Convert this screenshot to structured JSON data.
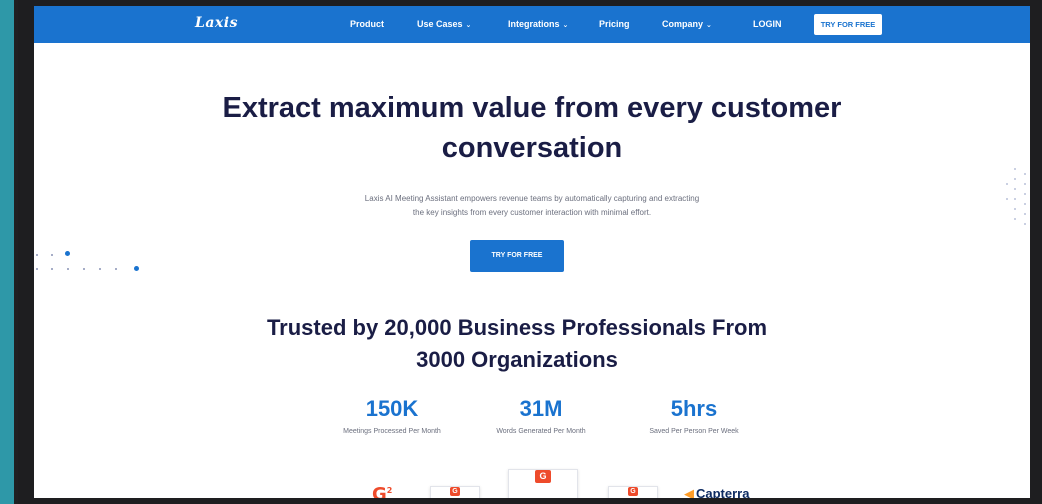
{
  "nav": {
    "logo": "Laxis",
    "items": [
      {
        "label": "Product",
        "caret": false
      },
      {
        "label": "Use Cases",
        "caret": true
      },
      {
        "label": "Integrations",
        "caret": true
      },
      {
        "label": "Pricing",
        "caret": false
      },
      {
        "label": "Company",
        "caret": true
      }
    ],
    "login": "LOGIN",
    "try_button": "TRY FOR FREE",
    "caret_glyph": "⌄"
  },
  "hero": {
    "title_line1": "Extract maximum value from every customer",
    "title_line2": "conversation",
    "subtitle_line1": "Laxis AI Meeting Assistant empowers revenue teams by automatically capturing and extracting",
    "subtitle_line2": "the key insights from every customer interaction with minimal effort.",
    "cta": "TRY FOR FREE"
  },
  "trusted": {
    "line1": "Trusted by 20,000 Business Professionals From",
    "line2": "3000 Organizations"
  },
  "stats": [
    {
      "value": "150K",
      "label": "Meetings Processed Per Month"
    },
    {
      "value": "31M",
      "label": "Words Generated Per Month"
    },
    {
      "value": "5hrs",
      "label": "Saved Per Person Per Week"
    }
  ],
  "badges": {
    "g2_logo": "G",
    "g2_sup": "2",
    "g2_mark": "G",
    "capterra": "Capterra"
  },
  "colors": {
    "brand_blue": "#1a73cf",
    "heading_navy": "#1a1d45",
    "frame_teal": "#2e98a8",
    "g2_red": "#ee4b2b"
  }
}
